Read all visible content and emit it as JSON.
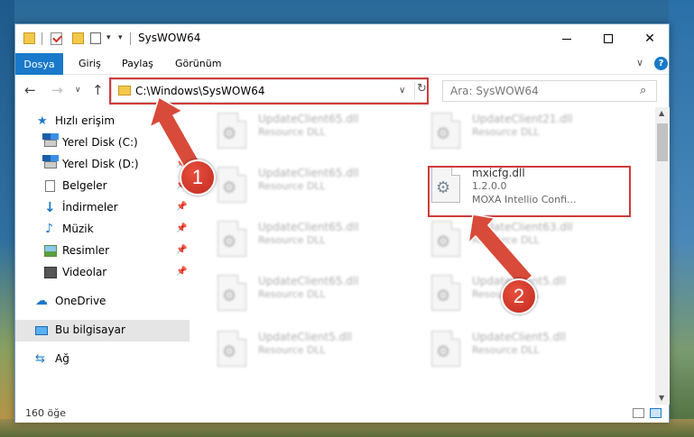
{
  "window": {
    "title": "SysWOW64",
    "controls": {
      "minimize": "",
      "maximize": "",
      "close": "✕"
    }
  },
  "quick_access": {
    "dropdown": "▾",
    "customize": "▾"
  },
  "ribbon": {
    "tabs": [
      "Dosya",
      "Giriş",
      "Paylaş",
      "Görünüm"
    ],
    "expand": "∨",
    "help": "?"
  },
  "nav": {
    "back": "←",
    "forward": "→",
    "recent": "∨",
    "up": "↑",
    "address": "C:\\Windows\\SysWOW64",
    "address_dropdown": "∨",
    "refresh": "↻",
    "search_placeholder": "Ara: SysWOW64",
    "search_icon": "⌕"
  },
  "sidebar": {
    "items": [
      {
        "label": "Hızlı erişim",
        "icon": "star-icon",
        "pinned": false
      },
      {
        "label": "Yerel Disk (C:)",
        "icon": "drive-icon",
        "pinned": false
      },
      {
        "label": "Yerel Disk (D:)",
        "icon": "drive-icon",
        "pinned": true
      },
      {
        "label": "Belgeler",
        "icon": "documents-icon",
        "pinned": true
      },
      {
        "label": "İndirmeler",
        "icon": "downloads-icon",
        "pinned": true
      },
      {
        "label": "Müzik",
        "icon": "music-icon",
        "pinned": true
      },
      {
        "label": "Resimler",
        "icon": "pictures-icon",
        "pinned": true
      },
      {
        "label": "Videolar",
        "icon": "videos-icon",
        "pinned": true
      },
      {
        "label": "OneDrive",
        "icon": "onedrive-icon",
        "pinned": false
      },
      {
        "label": "Bu bilgisayar",
        "icon": "computer-icon",
        "pinned": false,
        "selected": true
      },
      {
        "label": "Ağ",
        "icon": "network-icon",
        "pinned": false
      }
    ],
    "pin_glyph": "📌"
  },
  "files": [
    {
      "name": "UpdateClient65.dll",
      "type": "Resource DLL"
    },
    {
      "name": "UpdateClient21.dll",
      "type": "Resource DLL"
    },
    {
      "name": "UpdateClient65.dll",
      "type": "Resource DLL"
    },
    {
      "name": "mxicfg.dll",
      "version": "1.2.0.0",
      "description": "MOXA Intellio Confi..."
    },
    {
      "name": "UpdateClient65.dll",
      "type": "Resource DLL"
    },
    {
      "name": "UpdateClient63.dll",
      "type": "Resource DLL"
    },
    {
      "name": "UpdateClient65.dll",
      "type": "Resource DLL"
    },
    {
      "name": "UpdateClient5.dll",
      "type": "Resource DLL"
    },
    {
      "name": "UpdateClient5.dll",
      "type": "Resource DLL"
    },
    {
      "name": "UpdateClient5.dll",
      "type": "Resource DLL"
    }
  ],
  "callouts": {
    "step1": "1",
    "step2": "2"
  },
  "status": {
    "item_count": "160 öğe"
  },
  "colors": {
    "accent": "#1979ca",
    "highlight": "#d03a3a"
  }
}
